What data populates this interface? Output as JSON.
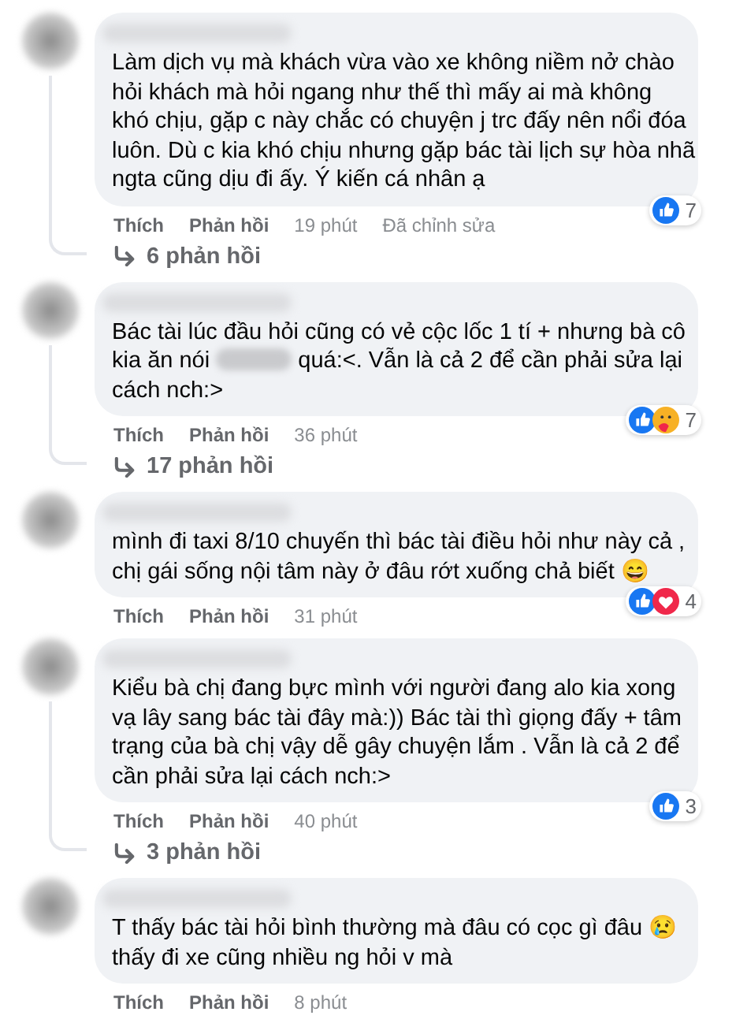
{
  "comments": [
    {
      "lines": [
        [
          {
            "kind": "text",
            "text": "Làm dịch vụ mà khách vừa vào xe không niềm nở chào"
          }
        ],
        [
          {
            "kind": "text",
            "text": "hỏi khách mà hỏi ngang như thế thì mấy ai mà không"
          }
        ],
        [
          {
            "kind": "text",
            "text": "khó chịu, gặp c này chắc có chuyện j trc đấy nên nổi đóa"
          }
        ],
        [
          {
            "kind": "text",
            "text": "luôn. Dù c kia khó chịu nhưng gặp bác tài lịch sự hòa nhã"
          }
        ],
        [
          {
            "kind": "text",
            "text": "ngta cũng dịu đi ấy. Ý kiến cá nhân ạ"
          }
        ]
      ],
      "reactions": [
        {
          "kind": "like"
        }
      ],
      "reaction_count": "7",
      "like": "Thích",
      "reply": "Phản hồi",
      "time": "19 phút",
      "edited": "Đã chỉnh sửa",
      "replies": "6 phản hồi"
    },
    {
      "lines": [
        [
          {
            "kind": "text",
            "text": "Bác tài lúc đầu hỏi cũng có vẻ cộc lốc 1 tí + nhưng bà cô"
          }
        ],
        [
          {
            "kind": "text",
            "text": "kia ăn nói "
          },
          {
            "kind": "blurred"
          },
          {
            "kind": "text",
            "text": " quá:<. Vẫn là cả 2 để cần phải sửa lại"
          }
        ],
        [
          {
            "kind": "text",
            "text": "cách nch:>"
          }
        ]
      ],
      "reactions": [
        {
          "kind": "like"
        },
        {
          "kind": "care"
        }
      ],
      "reaction_count": "7",
      "like": "Thích",
      "reply": "Phản hồi",
      "time": "36 phút",
      "replies": "17 phản hồi"
    },
    {
      "lines": [
        [
          {
            "kind": "text",
            "text": "mình đi taxi 8/10 chuyến thì bác tài điều hỏi như này cả ,"
          }
        ],
        [
          {
            "kind": "text",
            "text": "chị gái sống nội tâm này ở đâu rớt xuống chả biết 😄"
          }
        ]
      ],
      "reactions": [
        {
          "kind": "like"
        },
        {
          "kind": "love"
        }
      ],
      "reaction_count": "4",
      "like": "Thích",
      "reply": "Phản hồi",
      "time": "31 phút"
    },
    {
      "lines": [
        [
          {
            "kind": "text",
            "text": "Kiểu bà chị đang bực mình với người đang alo kia xong"
          }
        ],
        [
          {
            "kind": "text",
            "text": "vạ lây sang bác tài đây mà:)) Bác tài thì giọng đấy + tâm"
          }
        ],
        [
          {
            "kind": "text",
            "text": "trạng của bà chị vậy dễ gây chuyện lắm . Vẫn là cả 2 để"
          }
        ],
        [
          {
            "kind": "text",
            "text": "cần phải sửa lại cách nch:>"
          }
        ]
      ],
      "reactions": [
        {
          "kind": "like"
        }
      ],
      "reaction_count": "3",
      "like": "Thích",
      "reply": "Phản hồi",
      "time": "40 phút",
      "replies": "3 phản hồi"
    },
    {
      "lines": [
        [
          {
            "kind": "text",
            "text": "T thấy bác tài hỏi bình thường mà đâu có cọc gì đâu 😢"
          }
        ],
        [
          {
            "kind": "text",
            "text": "thấy đi xe cũng nhiều ng hỏi v mà"
          }
        ]
      ],
      "like": "Thích",
      "reply": "Phản hồi",
      "time": "8 phút"
    }
  ]
}
